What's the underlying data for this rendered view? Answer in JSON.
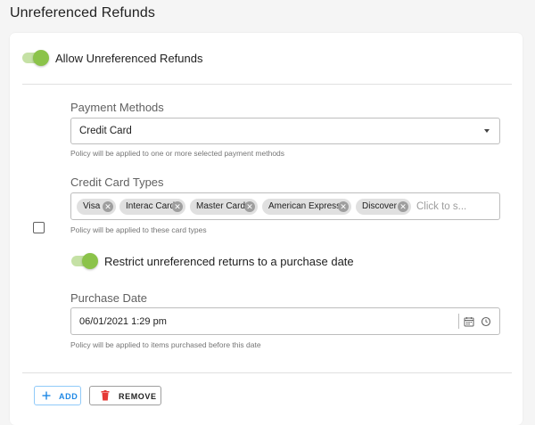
{
  "page": {
    "title": "Unreferenced Refunds"
  },
  "allow_toggle": {
    "label": "Allow Unreferenced Refunds",
    "checked": true
  },
  "payment_methods": {
    "label": "Payment Methods",
    "selected": "Credit Card",
    "helper": "Policy will be applied to one or more selected payment methods"
  },
  "card_types": {
    "label": "Credit Card Types",
    "chips": [
      {
        "label": "Visa"
      },
      {
        "label": "Interac Card"
      },
      {
        "label": "Master Card"
      },
      {
        "label": "American Express"
      },
      {
        "label": "Discover"
      }
    ],
    "placeholder": "Click to s...",
    "helper": "Policy will be applied to these card types"
  },
  "restrict_toggle": {
    "label": "Restrict unreferenced returns to a purchase date",
    "checked": true
  },
  "purchase_date": {
    "label": "Purchase Date",
    "value": "06/01/2021 1:29 pm",
    "helper": "Policy will be applied to items purchased before this date"
  },
  "actions": {
    "add_label": "ADD",
    "remove_label": "REMOVE"
  },
  "colors": {
    "toggle_on": "#8bc34a",
    "toggle_track": "#c5e1a5",
    "add_accent": "#1e88e5",
    "remove_icon": "#e53935"
  }
}
